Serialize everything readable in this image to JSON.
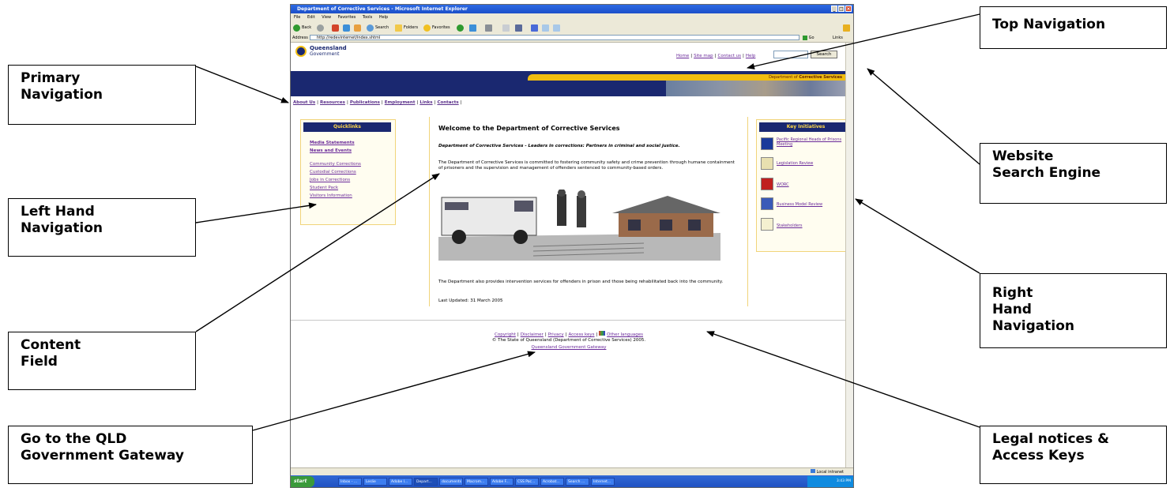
{
  "browser": {
    "title": "Department of Corrective Services - Microsoft Internet Explorer",
    "menu": [
      "File",
      "Edit",
      "View",
      "Favorites",
      "Tools",
      "Help"
    ],
    "toolbar": {
      "back": "Back",
      "search": "Search",
      "folders": "Folders",
      "favorites": "Favorites"
    },
    "address_label": "Address",
    "address_value": "http://redevinternet/index.shtml",
    "go_label": "Go",
    "links_label": "Links",
    "status_zone": "Local intranet"
  },
  "taskbar": {
    "start_label": "start",
    "tasks": [
      "Inbox - ...",
      "Leslie",
      "Adobe I...",
      "Depart...",
      "documents",
      "Macrom...",
      "Adobe F...",
      "CSS Pac...",
      "Acrobat...",
      "Search ...",
      "Internet..."
    ],
    "clock": "3:43 PM"
  },
  "page": {
    "logo_line1": "Queensland",
    "logo_line2": "Government",
    "top_nav": [
      "Home",
      "Site map",
      "Contact us",
      "Help"
    ],
    "search_button": "Search",
    "dept_prefix": "Department of ",
    "dept_bold": "Corrective Services",
    "primary_nav": [
      "About Us",
      "Resources",
      "Publications",
      "Employment",
      "Links",
      "Contacts"
    ],
    "quicklinks": {
      "heading": "Quicklinks",
      "bold_items": [
        "Media Statements",
        "News and Events"
      ],
      "items": [
        "Community Corrections",
        "Custodial Corrections",
        "Jobs in Corrections",
        "Student Pack",
        "Visitors Information"
      ]
    },
    "content": {
      "title": "Welcome to the Department of Corrective Services",
      "tagline": "Department of Corrective Services - Leaders in corrections: Partners in criminal and social justice.",
      "para1": "The Department of Corrective Services is committed to fostering community safety and crime prevention through humane containment of prisoners and the supervision and management of offenders sentenced to community-based orders.",
      "para2": "The Department also provides intervention services for offenders in prison and those being rehabilitated back into the community.",
      "last_updated": "Last Updated: 31 March 2005"
    },
    "key_initiatives": {
      "heading": "Key Initiatives",
      "items": [
        "Pacific Regional Heads of Prisons Meeting",
        "Legislation Review",
        "WORC",
        "Business Model Review",
        "Stakeholders"
      ]
    },
    "footer": {
      "links": [
        "Copyright",
        "Disclaimer",
        "Privacy",
        "Access keys",
        "Other languages"
      ],
      "copyright": "© The State of Queensland (Department of Corrective Services) 2005.",
      "gateway": "Queensland Government Gateway"
    }
  },
  "callouts": {
    "top_navigation": [
      "Top Navigation"
    ],
    "primary_navigation": [
      "Primary",
      "Navigation"
    ],
    "website_search_engine": [
      "Website",
      "Search Engine"
    ],
    "left_hand_navigation": [
      "Left Hand",
      "Navigation"
    ],
    "right_hand_navigation": [
      "Right",
      "Hand",
      "Navigation"
    ],
    "content_field": [
      "Content",
      "Field"
    ],
    "qld_gateway": [
      "Go to the QLD",
      "Government Gateway"
    ],
    "legal_notices": [
      "Legal notices &",
      "Access Keys"
    ]
  }
}
